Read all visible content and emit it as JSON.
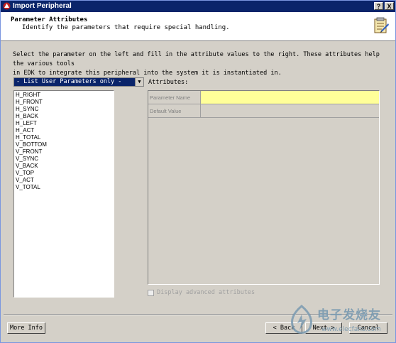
{
  "window": {
    "title": "Import Peripheral",
    "help_label": "?",
    "close_label": "X"
  },
  "header": {
    "title": "Parameter Attributes",
    "subtitle": "Identify the parameters that require special handling."
  },
  "instructions": {
    "line1": "Select the parameter on the left and fill in the attribute values to the right. These attributes help the various tools",
    "line2": "in EDK to integrate this peripheral into the system it is instantiated in."
  },
  "filter": {
    "selected": "- List User Parameters only -",
    "arrow": "▼"
  },
  "parameters": [
    "H_RIGHT",
    "H_FRONT",
    "H_SYNC",
    "H_BACK",
    "H_LEFT",
    "H_ACT",
    "H_TOTAL",
    "V_BOTTOM",
    "V_FRONT",
    "V_SYNC",
    "V_BACK",
    "V_TOP",
    "V_ACT",
    "V_TOTAL"
  ],
  "attributes": {
    "label": "Attributes:",
    "rows": [
      {
        "name": "Parameter Name",
        "value": ""
      },
      {
        "name": "Default Value",
        "value": ""
      }
    ]
  },
  "advanced": {
    "label": "Display advanced attributes",
    "checked": false
  },
  "buttons": {
    "more_info": "More Info",
    "back": "< Back",
    "next": "Next >",
    "cancel": "Cancel"
  },
  "watermark": {
    "text": "电子发烧友",
    "url": "www.elecfans.com"
  },
  "colors": {
    "titlebar": "#0a246a",
    "highlight": "#ffff99",
    "face": "#d4d0c8"
  }
}
